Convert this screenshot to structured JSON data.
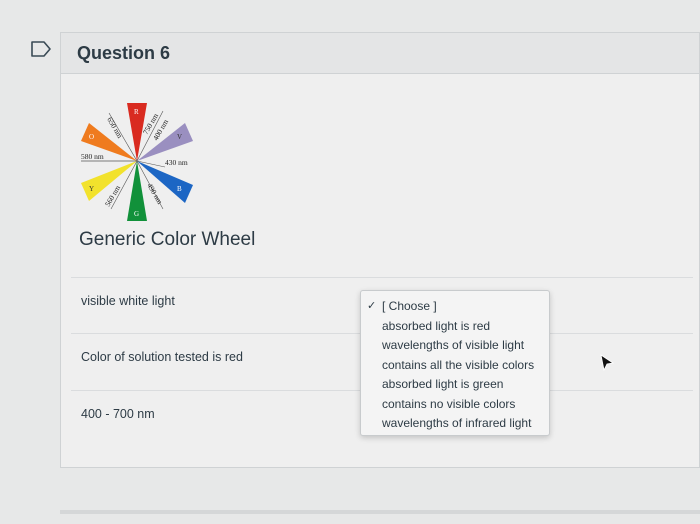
{
  "question": {
    "title": "Question 6"
  },
  "wheel": {
    "caption": "Generic Color Wheel",
    "labels": {
      "nm650": "650 nm",
      "nm750": "750 nm",
      "nm400": "400 nm",
      "nm580": "580 nm",
      "nm430": "430 nm",
      "nm560": "560 nm",
      "nm490": "490 nm"
    },
    "segments": {
      "red": "R",
      "violet": "V",
      "blue": "B",
      "green": "G",
      "yellow": "Y",
      "orange": "O"
    }
  },
  "rows": [
    {
      "label": "visible white light"
    },
    {
      "label": "Color of solution tested is red"
    },
    {
      "label": "400 - 700 nm"
    }
  ],
  "dropdown": {
    "checkmark": "✓",
    "options": [
      "[ Choose ]",
      "absorbed light is red",
      "wavelengths of visible light",
      "contains all the visible colors",
      "absorbed light is green",
      "contains no visible colors",
      "wavelengths of infrared light"
    ]
  },
  "colors": {
    "red": "#d92b20",
    "violet": "#9a8fc0",
    "blue": "#1c66c4",
    "green": "#11913a",
    "yellow": "#f2e22c",
    "orange": "#ef7b1e"
  }
}
